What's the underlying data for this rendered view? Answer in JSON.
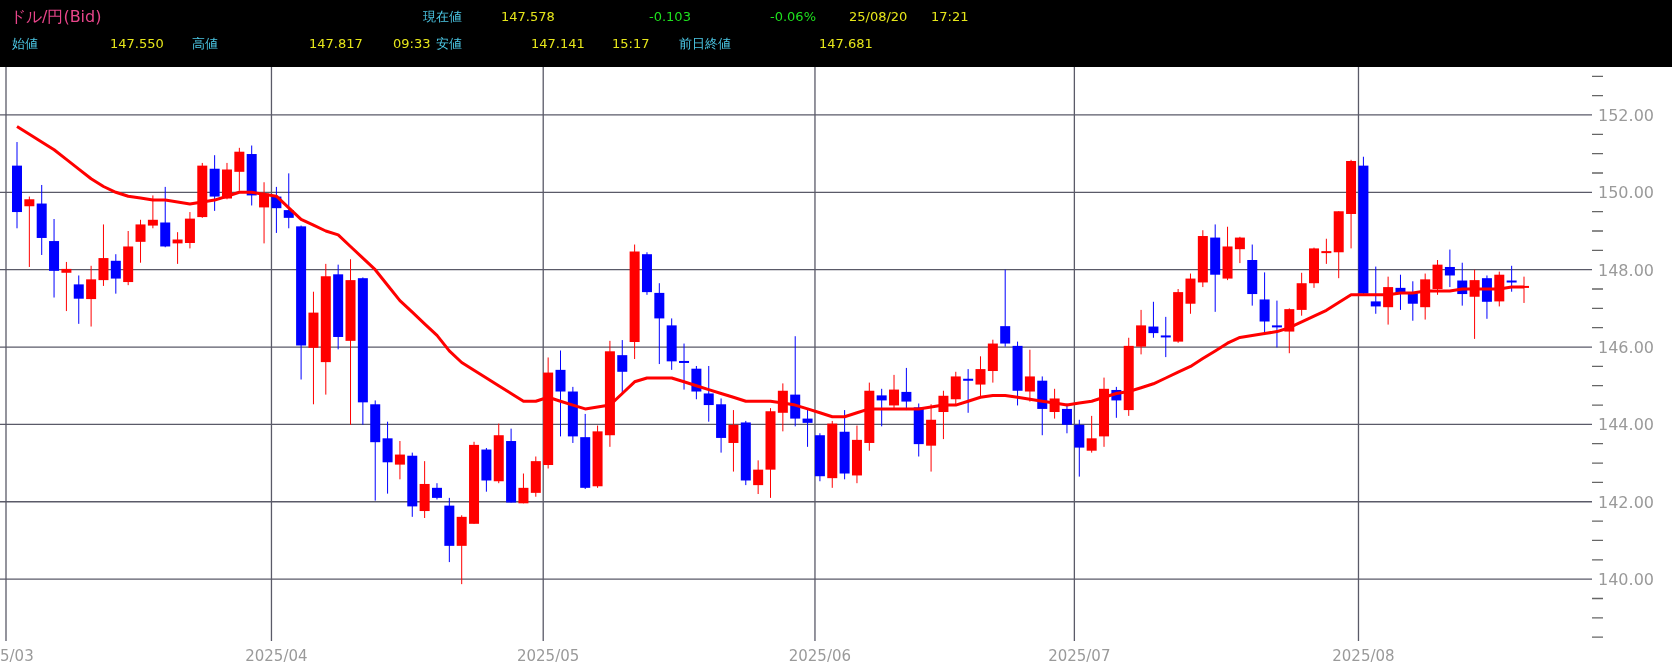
{
  "quote": {
    "pair": "ドル/円(Bid)",
    "current_label": "現在値",
    "current_price": "147.578",
    "change": "-0.103",
    "change_percent": "-0.06%",
    "date": "25/08/20",
    "time": "17:21",
    "open_label": "始値",
    "open": "147.550",
    "high_label": "高値",
    "high": "147.817",
    "high_time": "09:33",
    "low_label": "安値",
    "low": "147.141",
    "low_time": "15:17",
    "prev_close_label": "前日終値",
    "prev_close": "147.681"
  },
  "chart": {
    "chart_data": {
      "type": "candlestick",
      "grid": true,
      "ylim": [
        138.4,
        153.24
      ],
      "yticks": [
        {
          "value": 140,
          "label": "140.00"
        },
        {
          "value": 142,
          "label": "142.00"
        },
        {
          "value": 144,
          "label": "144.00"
        },
        {
          "value": 146,
          "label": "146.00"
        },
        {
          "value": 148,
          "label": "148.00"
        },
        {
          "value": 150,
          "label": "150.00"
        },
        {
          "value": 152,
          "label": "152.00"
        }
      ],
      "categories": [
        "5/03",
        null,
        null,
        null,
        null,
        null,
        null,
        null,
        null,
        null,
        null,
        null,
        null,
        null,
        null,
        null,
        null,
        null,
        null,
        null,
        null,
        "2025/04",
        null,
        null,
        null,
        null,
        null,
        null,
        null,
        null,
        null,
        null,
        null,
        null,
        null,
        null,
        null,
        null,
        null,
        null,
        null,
        null,
        null,
        "2025/05",
        null,
        null,
        null,
        null,
        null,
        null,
        null,
        null,
        null,
        null,
        null,
        null,
        null,
        null,
        null,
        null,
        null,
        null,
        null,
        null,
        null,
        "2025/06",
        null,
        null,
        null,
        null,
        null,
        null,
        null,
        null,
        null,
        null,
        null,
        null,
        null,
        null,
        null,
        null,
        null,
        null,
        null,
        null,
        "2025/07",
        null,
        null,
        null,
        null,
        null,
        null,
        null,
        null,
        null,
        null,
        null,
        null,
        null,
        null,
        null,
        null,
        null,
        null,
        null,
        null,
        null,
        null,
        "2025/08",
        null,
        null,
        null,
        null,
        null,
        null,
        null,
        null,
        null,
        null,
        null,
        null,
        null
      ],
      "ohlc": [
        [
          150.69,
          151.3,
          149.07,
          149.49
        ],
        [
          149.64,
          149.89,
          148.07,
          149.82
        ],
        [
          149.71,
          150.19,
          148.38,
          148.82
        ],
        [
          148.74,
          149.31,
          147.28,
          147.97
        ],
        [
          147.92,
          148.2,
          146.93,
          148.02
        ],
        [
          147.62,
          147.85,
          146.6,
          147.25
        ],
        [
          147.24,
          148.1,
          146.53,
          147.75
        ],
        [
          147.73,
          149.17,
          147.58,
          148.3
        ],
        [
          148.23,
          148.4,
          147.38,
          147.77
        ],
        [
          147.68,
          149.0,
          147.6,
          148.6
        ],
        [
          148.72,
          149.29,
          148.18,
          149.17
        ],
        [
          149.14,
          149.92,
          149.07,
          149.29
        ],
        [
          149.22,
          150.14,
          148.58,
          148.6
        ],
        [
          148.68,
          148.97,
          148.15,
          148.78
        ],
        [
          148.69,
          149.49,
          148.55,
          149.32
        ],
        [
          149.36,
          150.76,
          149.34,
          150.69
        ],
        [
          150.61,
          150.96,
          149.52,
          149.89
        ],
        [
          149.84,
          150.76,
          149.82,
          150.59
        ],
        [
          150.53,
          151.15,
          150.04,
          151.05
        ],
        [
          150.99,
          151.21,
          149.66,
          149.92
        ],
        [
          149.61,
          150.26,
          148.68,
          149.97
        ],
        [
          149.89,
          150.14,
          148.95,
          149.59
        ],
        [
          149.54,
          150.49,
          149.07,
          149.34
        ],
        [
          149.12,
          149.14,
          145.16,
          146.04
        ],
        [
          145.98,
          147.43,
          144.52,
          146.89
        ],
        [
          145.61,
          148.15,
          144.77,
          147.83
        ],
        [
          147.88,
          148.13,
          145.94,
          146.26
        ],
        [
          146.16,
          148.27,
          143.99,
          147.73
        ],
        [
          147.78,
          147.8,
          143.99,
          144.57
        ],
        [
          144.52,
          144.62,
          142.03,
          143.54
        ],
        [
          143.64,
          144.07,
          142.21,
          143.02
        ],
        [
          142.96,
          143.57,
          142.58,
          143.22
        ],
        [
          143.19,
          143.27,
          141.61,
          141.88
        ],
        [
          141.76,
          143.05,
          141.58,
          142.46
        ],
        [
          142.36,
          142.48,
          142.06,
          142.1
        ],
        [
          141.9,
          142.1,
          140.44,
          140.86
        ],
        [
          140.86,
          141.65,
          139.87,
          141.61
        ],
        [
          141.43,
          143.55,
          141.43,
          143.47
        ],
        [
          143.35,
          143.39,
          142.26,
          142.55
        ],
        [
          142.53,
          144.02,
          142.48,
          143.72
        ],
        [
          143.57,
          143.89,
          141.98,
          141.98
        ],
        [
          141.96,
          142.73,
          141.96,
          142.36
        ],
        [
          142.23,
          143.17,
          142.13,
          143.05
        ],
        [
          142.95,
          145.73,
          142.86,
          145.34
        ],
        [
          145.41,
          145.91,
          143.69,
          144.85
        ],
        [
          144.85,
          144.97,
          143.52,
          143.69
        ],
        [
          143.67,
          144.27,
          142.33,
          142.36
        ],
        [
          142.4,
          143.97,
          142.36,
          143.82
        ],
        [
          143.72,
          146.16,
          143.42,
          145.89
        ],
        [
          145.79,
          146.18,
          144.8,
          145.36
        ],
        [
          146.13,
          148.65,
          145.69,
          148.47
        ],
        [
          148.4,
          148.45,
          147.35,
          147.42
        ],
        [
          147.4,
          147.65,
          145.56,
          146.74
        ],
        [
          146.56,
          146.74,
          145.41,
          145.63
        ],
        [
          145.64,
          146.09,
          144.9,
          145.61
        ],
        [
          145.44,
          145.51,
          144.65,
          144.85
        ],
        [
          144.8,
          145.51,
          144.07,
          144.5
        ],
        [
          144.52,
          144.67,
          143.27,
          143.65
        ],
        [
          143.52,
          144.37,
          142.78,
          143.99
        ],
        [
          144.05,
          144.09,
          142.43,
          142.55
        ],
        [
          142.43,
          143.07,
          142.2,
          142.83
        ],
        [
          142.83,
          144.42,
          142.1,
          144.34
        ],
        [
          144.3,
          145.06,
          143.82,
          144.87
        ],
        [
          144.77,
          146.28,
          143.95,
          144.15
        ],
        [
          144.15,
          144.42,
          143.42,
          144.04
        ],
        [
          143.72,
          143.77,
          142.53,
          142.66
        ],
        [
          142.61,
          144.09,
          142.36,
          144.02
        ],
        [
          143.81,
          144.37,
          142.58,
          142.73
        ],
        [
          142.68,
          143.97,
          142.48,
          143.6
        ],
        [
          143.52,
          145.08,
          143.32,
          144.87
        ],
        [
          144.75,
          144.92,
          143.95,
          144.62
        ],
        [
          144.49,
          145.28,
          144.42,
          144.9
        ],
        [
          144.84,
          145.46,
          144.37,
          144.59
        ],
        [
          144.44,
          144.54,
          143.17,
          143.49
        ],
        [
          143.45,
          144.52,
          142.78,
          144.12
        ],
        [
          144.32,
          144.87,
          143.62,
          144.74
        ],
        [
          144.65,
          145.36,
          144.52,
          145.24
        ],
        [
          145.18,
          145.43,
          144.3,
          145.14
        ],
        [
          145.03,
          145.76,
          144.72,
          145.43
        ],
        [
          145.38,
          146.19,
          145.08,
          146.09
        ],
        [
          146.54,
          148.0,
          146.01,
          146.09
        ],
        [
          146.03,
          146.14,
          144.49,
          144.87
        ],
        [
          144.85,
          145.93,
          144.59,
          145.24
        ],
        [
          145.13,
          145.24,
          143.72,
          144.4
        ],
        [
          144.32,
          144.92,
          144.15,
          144.67
        ],
        [
          144.4,
          144.54,
          143.77,
          143.99
        ],
        [
          143.99,
          144.12,
          142.65,
          143.4
        ],
        [
          143.32,
          144.22,
          143.27,
          143.64
        ],
        [
          143.69,
          145.21,
          143.42,
          144.92
        ],
        [
          144.89,
          144.97,
          144.17,
          144.62
        ],
        [
          144.37,
          146.24,
          144.22,
          146.03
        ],
        [
          146.01,
          146.96,
          145.81,
          146.56
        ],
        [
          146.53,
          147.17,
          146.24,
          146.36
        ],
        [
          146.3,
          146.78,
          145.74,
          146.26
        ],
        [
          146.14,
          147.5,
          146.11,
          147.42
        ],
        [
          147.12,
          147.9,
          146.86,
          147.77
        ],
        [
          147.67,
          149.02,
          147.55,
          148.87
        ],
        [
          148.83,
          149.17,
          146.91,
          147.87
        ],
        [
          147.77,
          149.11,
          147.73,
          148.6
        ],
        [
          148.53,
          148.85,
          148.17,
          148.83
        ],
        [
          148.25,
          148.65,
          147.07,
          147.37
        ],
        [
          147.23,
          147.93,
          146.31,
          146.66
        ],
        [
          146.56,
          147.2,
          145.99,
          146.51
        ],
        [
          146.4,
          147.0,
          145.84,
          146.98
        ],
        [
          146.96,
          147.92,
          146.81,
          147.65
        ],
        [
          147.65,
          148.57,
          147.53,
          148.55
        ],
        [
          148.45,
          148.8,
          148.15,
          148.48
        ],
        [
          148.45,
          149.51,
          147.78,
          149.51
        ],
        [
          149.44,
          150.84,
          148.55,
          150.81
        ],
        [
          150.69,
          150.92,
          147.35,
          147.38
        ],
        [
          147.18,
          148.08,
          146.86,
          147.05
        ],
        [
          147.03,
          147.82,
          146.58,
          147.55
        ],
        [
          147.53,
          147.87,
          146.96,
          147.38
        ],
        [
          147.39,
          147.7,
          146.68,
          147.12
        ],
        [
          147.03,
          147.9,
          146.71,
          147.75
        ],
        [
          147.5,
          148.25,
          147.35,
          148.13
        ],
        [
          148.07,
          148.52,
          147.55,
          147.85
        ],
        [
          147.72,
          148.18,
          147.07,
          147.37
        ],
        [
          147.3,
          148.0,
          146.21,
          147.73
        ],
        [
          147.78,
          147.85,
          146.73,
          147.17
        ],
        [
          147.18,
          147.95,
          147.05,
          147.87
        ],
        [
          147.72,
          148.1,
          147.43,
          147.67
        ],
        [
          147.55,
          147.82,
          147.14,
          147.58
        ]
      ],
      "series": [
        {
          "type": "line",
          "color": "#ff0000",
          "values": [
            151.7,
            151.5,
            151.3,
            151.1,
            150.85,
            150.6,
            150.35,
            150.15,
            150.0,
            149.9,
            149.85,
            149.8,
            149.8,
            149.75,
            149.7,
            149.75,
            149.8,
            149.9,
            150.0,
            150.0,
            149.95,
            149.9,
            149.6,
            149.3,
            149.15,
            149.0,
            148.9,
            148.6,
            148.3,
            148.0,
            147.6,
            147.2,
            146.9,
            146.6,
            146.3,
            145.9,
            145.6,
            145.4,
            145.2,
            145.0,
            144.8,
            144.6,
            144.6,
            144.7,
            144.6,
            144.5,
            144.4,
            144.45,
            144.5,
            144.8,
            145.1,
            145.2,
            145.2,
            145.2,
            145.1,
            145.0,
            144.9,
            144.8,
            144.7,
            144.6,
            144.6,
            144.6,
            144.55,
            144.5,
            144.4,
            144.3,
            144.2,
            144.2,
            144.3,
            144.4,
            144.4,
            144.4,
            144.4,
            144.4,
            144.45,
            144.5,
            144.5,
            144.6,
            144.7,
            144.75,
            144.75,
            144.7,
            144.65,
            144.6,
            144.55,
            144.5,
            144.55,
            144.6,
            144.7,
            144.8,
            144.85,
            144.95,
            145.05,
            145.2,
            145.35,
            145.5,
            145.7,
            145.9,
            146.1,
            146.25,
            146.3,
            146.35,
            146.4,
            146.5,
            146.65,
            146.8,
            146.95,
            147.15,
            147.35,
            147.35,
            147.35,
            147.35,
            147.4,
            147.4,
            147.45,
            147.45,
            147.45,
            147.5,
            147.5,
            147.5,
            147.5,
            147.55,
            147.55
          ]
        }
      ]
    }
  }
}
